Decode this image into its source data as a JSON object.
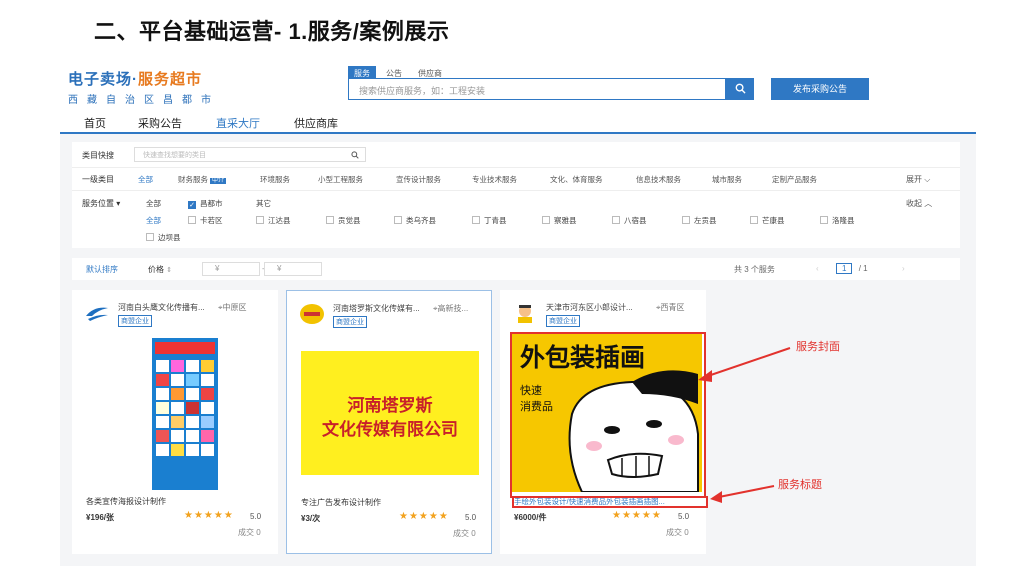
{
  "slide_title": "二、平台基础运营- 1.服务/案例展示",
  "header": {
    "logo_part1": "电子卖场·",
    "logo_part2": "服务超市",
    "logo_sub": "西藏自治区昌都市",
    "search_tabs": [
      "服务",
      "公告",
      "供应商"
    ],
    "search_placeholder": "搜索供应商服务，如：工程安装",
    "publish_label": "发布采购公告"
  },
  "nav": [
    "首页",
    "采购公告",
    "直采大厅",
    "供应商库"
  ],
  "filter": {
    "quick_label": "类目快搜",
    "quick_placeholder": "快速查找想要的类目",
    "level1_label": "一级类目",
    "categories": [
      "全部",
      "财务服务",
      "环境服务",
      "小型工程服务",
      "宣传设计服务",
      "专业技术服务",
      "文化、体育服务",
      "信息技术服务",
      "城市服务",
      "定制产品服务"
    ],
    "new_tag": "中介",
    "expand_label": "展开",
    "location_label": "服务位置",
    "loc_row1": [
      "全部",
      "昌都市",
      "其它"
    ],
    "collapse_label": "收起",
    "districts": [
      "全部",
      "卡若区",
      "江达县",
      "贡觉县",
      "类乌齐县",
      "丁青县",
      "察雅县",
      "八宿县",
      "左贡县",
      "芒康县",
      "洛隆县",
      "边坝县"
    ]
  },
  "sortbar": {
    "default_sort": "默认排序",
    "price_label": "价格",
    "price_sym1": "¥",
    "price_sym2": "¥",
    "dash": "-",
    "total": "共 3 个服务",
    "page_current": "1",
    "page_total": "/ 1"
  },
  "cards": [
    {
      "company": "河南白头鹰文化传播有...",
      "district": "中原区",
      "badge": "商盟企业",
      "title": "各类宣传海报设计制作",
      "price": "¥196/张",
      "stars": "★★★★★",
      "score": "5.0",
      "deals": "成交 0"
    },
    {
      "company": "河南塔罗斯文化传媒有...",
      "district": "高新技...",
      "badge": "商盟企业",
      "cover_line1": "河南塔罗斯",
      "cover_line2": "文化传媒有限公司",
      "title": "专注广告发布设计制作",
      "price": "¥3/次",
      "stars": "★★★★★",
      "score": "5.0",
      "deals": "成交 0"
    },
    {
      "company": "天津市河东区小郎设计...",
      "district": "西青区",
      "badge": "商盟企业",
      "cover_title": "外包装插画",
      "cover_l1": "快速",
      "cover_l2": "消费品",
      "title": "手绘外包装设计/快速消费品外包装插画插图...",
      "price": "¥6000/件",
      "stars": "★★★★★",
      "score": "5.0",
      "deals": "成交 0"
    }
  ],
  "annotations": {
    "cover": "服务封面",
    "title": "服务标题"
  },
  "colors": {
    "primary": "#2f78c4",
    "accent": "#e77a1f",
    "annotation": "#e2322d",
    "star": "#f2a21e",
    "yellow_cover": "#ffef1f"
  }
}
